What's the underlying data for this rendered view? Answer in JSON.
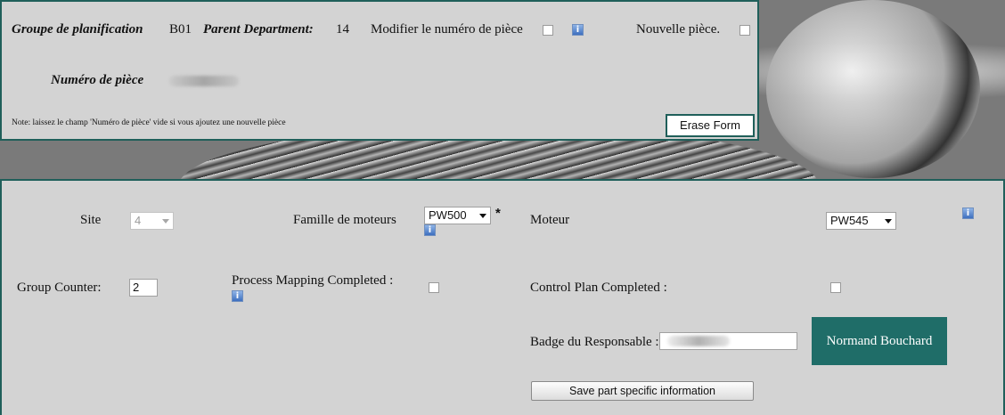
{
  "header": {
    "planning_group_label": "Groupe de planification",
    "planning_group_value": "B01",
    "parent_department_label": "Parent Department:",
    "parent_department_value": "14",
    "modify_part_label": "Modifier le numéro de pièce",
    "new_part_label": "Nouvelle pièce.",
    "part_number_label": "Numéro de pièce",
    "note": "Note: laissez le champ 'Numéro de pièce' vide si vous ajoutez une nouvelle pièce",
    "erase_button": "Erase Form"
  },
  "form": {
    "site_label": "Site",
    "site_value": "4",
    "engine_family_label": "Famille de moteurs",
    "engine_family_value": "PW500",
    "required_mark": "*",
    "engine_label": "Moteur",
    "engine_value": "PW545",
    "group_counter_label": "Group Counter:",
    "group_counter_value": "2",
    "process_mapping_label": "Process Mapping Completed :",
    "control_plan_label": "Control Plan Completed :",
    "badge_label": "Badge du Responsable :",
    "responsible_name": "Normand Bouchard",
    "save_button": "Save part specific information"
  },
  "icons": {
    "info": "i"
  }
}
